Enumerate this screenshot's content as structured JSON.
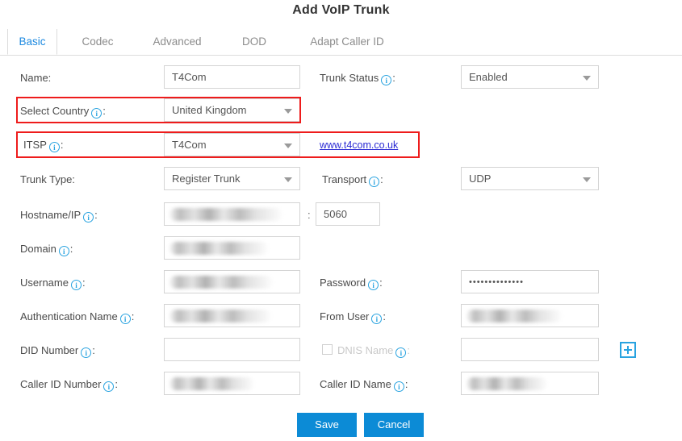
{
  "dialog": {
    "title": "Add VoIP Trunk"
  },
  "tabs": [
    {
      "label": "Basic",
      "active": true
    },
    {
      "label": "Codec",
      "active": false
    },
    {
      "label": "Advanced",
      "active": false
    },
    {
      "label": "DOD",
      "active": false
    },
    {
      "label": "Adapt Caller ID",
      "active": false
    }
  ],
  "form": {
    "name": {
      "label": "Name:",
      "value": "T4Com"
    },
    "trunk_status": {
      "label": "Trunk Status",
      "value": "Enabled"
    },
    "select_country": {
      "label": "Select Country",
      "value": "United Kingdom"
    },
    "itsp": {
      "label": "ITSP",
      "value": "T4Com",
      "link": "www.t4com.co.uk"
    },
    "trunk_type": {
      "label": "Trunk Type:",
      "value": "Register Trunk"
    },
    "transport": {
      "label": "Transport",
      "value": "UDP"
    },
    "hostname_ip": {
      "label": "Hostname/IP",
      "value": "",
      "redacted": true
    },
    "port": {
      "label": ":",
      "value": "5060"
    },
    "domain": {
      "label": "Domain",
      "value": "",
      "redacted": true
    },
    "username": {
      "label": "Username",
      "value": "",
      "redacted": true
    },
    "password": {
      "label": "Password",
      "value": "••••••••••••••"
    },
    "authentication_name": {
      "label": "Authentication Name",
      "value": "",
      "redacted": true
    },
    "from_user": {
      "label": "From User",
      "value": "",
      "redacted": true
    },
    "did_number": {
      "label": "DID Number",
      "value": ""
    },
    "dnis_name": {
      "label": "DNIS Name",
      "value": "",
      "checked": false,
      "disabled": true
    },
    "caller_id_number": {
      "label": "Caller ID Number",
      "value": "",
      "redacted": true
    },
    "caller_id_name": {
      "label": "Caller ID Name",
      "value": "",
      "redacted": true
    }
  },
  "footer": {
    "save_label": "Save",
    "cancel_label": "Cancel"
  },
  "icons": {
    "info": "i",
    "plus": "plus-icon",
    "caret": "chevron-down-icon"
  },
  "colors": {
    "accent_blue": "#0c8bd6",
    "info_blue": "#29a3e0",
    "highlight_red": "#ee1c1c",
    "link_blue": "#2b2bd4",
    "tab_active": "#1e8ae0"
  }
}
